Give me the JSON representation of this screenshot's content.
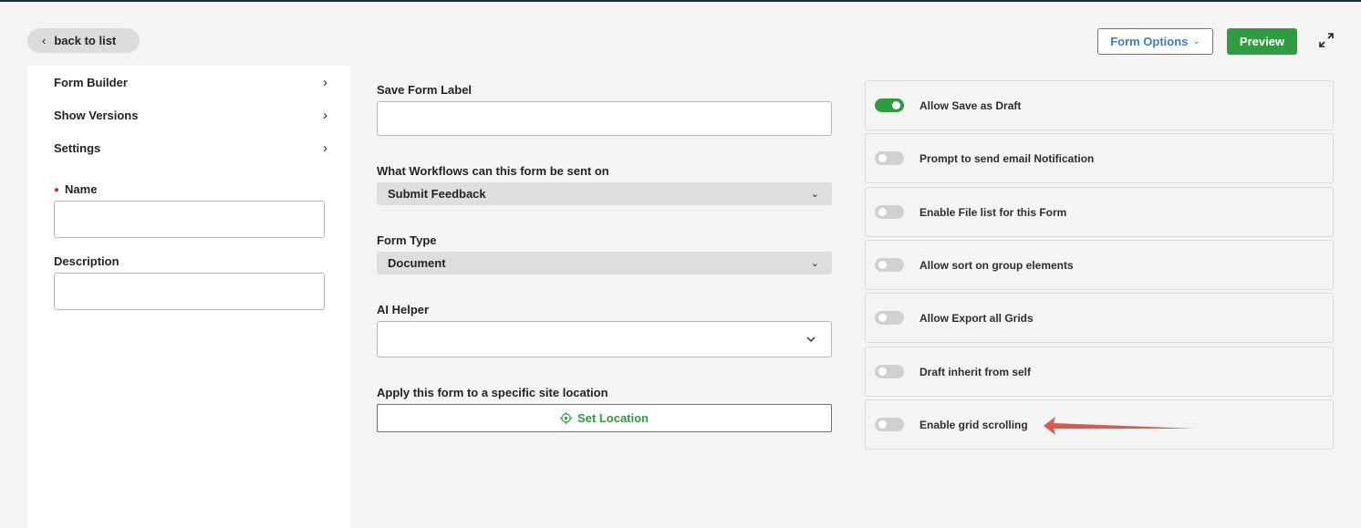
{
  "header": {
    "back_label": "back to list",
    "form_options_label": "Form Options",
    "preview_label": "Preview"
  },
  "left_nav": {
    "items": [
      {
        "label": "Form Builder"
      },
      {
        "label": "Show Versions"
      },
      {
        "label": "Settings"
      }
    ],
    "name_label": "Name",
    "name_value": "",
    "description_label": "Description",
    "description_value": ""
  },
  "middle": {
    "save_form_label": "Save Form Label",
    "save_form_value": "",
    "workflows_label": "What Workflows can this form be sent on",
    "workflows_value": "Submit Feedback",
    "form_type_label": "Form Type",
    "form_type_value": "Document",
    "ai_helper_label": "AI Helper",
    "ai_helper_value": "",
    "location_label": "Apply this form to a specific site location",
    "set_location_label": "Set Location"
  },
  "options": [
    {
      "label": "Allow Save as Draft",
      "on": true
    },
    {
      "label": "Prompt to send email Notification",
      "on": false
    },
    {
      "label": "Enable File list for this Form",
      "on": false
    },
    {
      "label": "Allow sort on group elements",
      "on": false
    },
    {
      "label": "Allow Export all Grids",
      "on": false
    },
    {
      "label": "Draft inherit from self",
      "on": false
    },
    {
      "label": "Enable grid scrolling",
      "on": false
    }
  ],
  "colors": {
    "accent_green": "#2e9c3f",
    "accent_blue": "#3a7bd5",
    "annotation_red": "#e0574a"
  }
}
